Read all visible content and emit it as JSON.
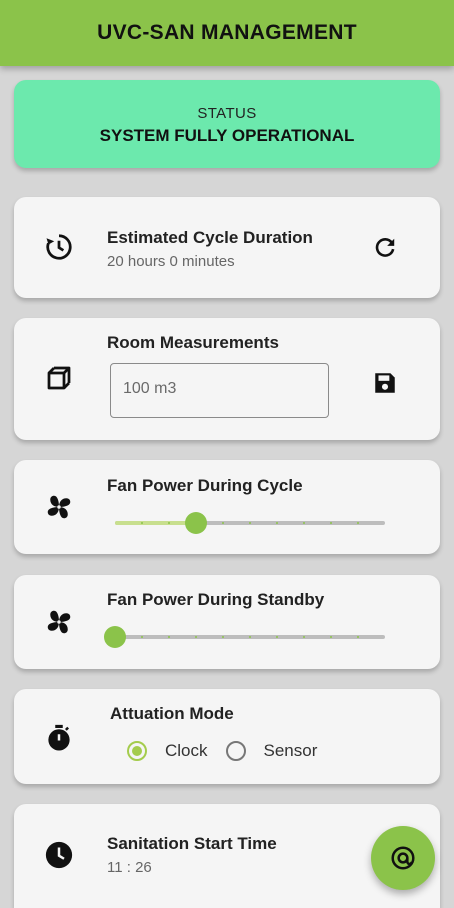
{
  "app": {
    "title": "UVC-SAN MANAGEMENT"
  },
  "status": {
    "label": "STATUS",
    "value": "SYSTEM FULLY OPERATIONAL"
  },
  "cycle": {
    "title": "Estimated Cycle Duration",
    "value": "20 hours 0 minutes",
    "icon": "clock-refresh-icon",
    "action_icon": "refresh-icon"
  },
  "room": {
    "title": "Room Measurements",
    "input_value": "100 m3",
    "icon": "cube-icon",
    "action_icon": "save-icon"
  },
  "fan_cycle": {
    "title": "Fan Power During Cycle",
    "level_percent": 30,
    "steps": 10,
    "icon": "fan-icon"
  },
  "fan_standby": {
    "title": "Fan Power During Standby",
    "level_percent": 0,
    "steps": 10,
    "icon": "fan-icon"
  },
  "attuation": {
    "title": "Attuation Mode",
    "icon": "stopwatch-icon",
    "options": [
      {
        "label": "Clock",
        "selected": true
      },
      {
        "label": "Sensor",
        "selected": false
      }
    ]
  },
  "start_time": {
    "title": "Sanitation Start Time",
    "value": "11 : 26",
    "icon": "clock-icon"
  },
  "fab": {
    "icon": "at-target-icon"
  },
  "colors": {
    "accent": "#8bc34a",
    "status_bg": "#6ce9ad",
    "radio_selected": "#a4cc4c",
    "background": "#d6d6d6"
  }
}
